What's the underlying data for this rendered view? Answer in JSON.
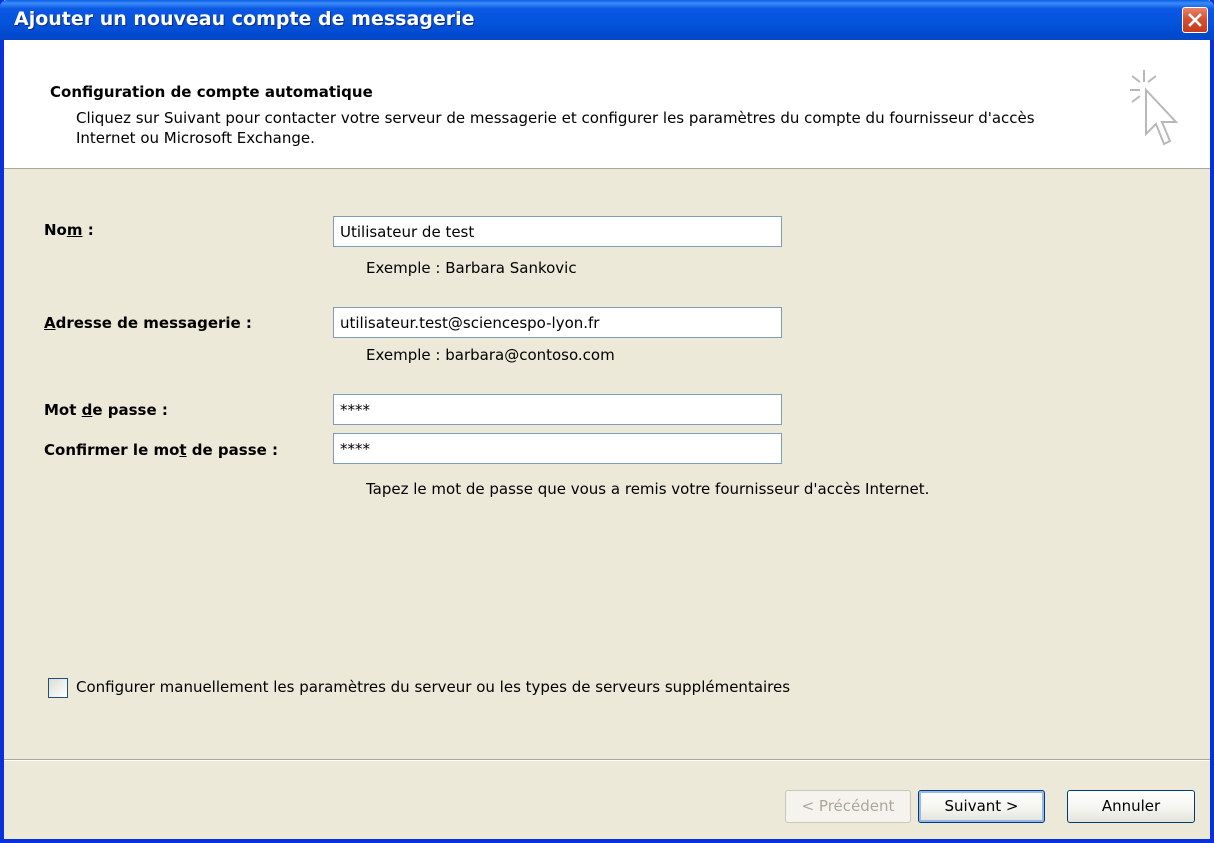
{
  "window": {
    "title": "Ajouter un nouveau compte de messagerie",
    "close_icon": "close-icon"
  },
  "header": {
    "title": "Configuration de compte automatique",
    "description": "Cliquez sur Suivant pour contacter votre serveur de messagerie et configurer les paramètres du compte du fournisseur d'accès Internet ou Microsoft Exchange.",
    "icon": "wizard-cursor-icon"
  },
  "form": {
    "name": {
      "label": "Nom :",
      "value": "Utilisateur de test",
      "hint": "Exemple : Barbara Sankovic"
    },
    "email": {
      "label": "Adresse de messagerie :",
      "value": "utilisateur.test@sciencespo-lyon.fr",
      "hint": "Exemple : barbara@contoso.com"
    },
    "password": {
      "label": "Mot de passe :",
      "value": "****"
    },
    "confirm_password": {
      "label": "Confirmer le mot de passe :",
      "value": "****",
      "hint": "Tapez le mot de passe que vous a remis votre fournisseur d'accès Internet."
    }
  },
  "manual_config": {
    "label": "Configurer manuellement les paramètres du serveur ou les types de serveurs supplémentaires",
    "checked": false
  },
  "buttons": {
    "previous": "< Précédent",
    "next": "Suivant >",
    "cancel": "Annuler"
  }
}
